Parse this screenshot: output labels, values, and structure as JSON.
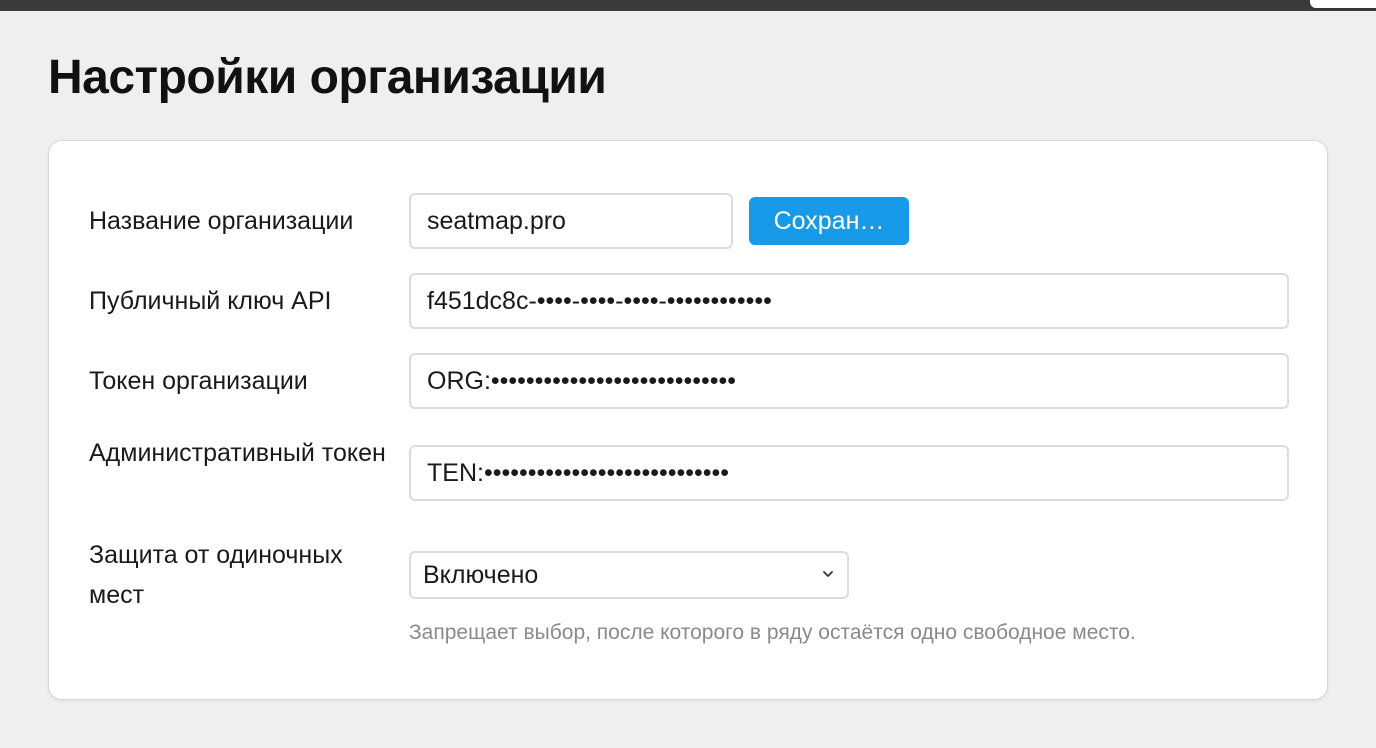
{
  "page": {
    "title": "Настройки организации"
  },
  "form": {
    "org_name": {
      "label": "Название организации",
      "value": "seatmap.pro",
      "save_label": "Сохран…"
    },
    "public_api_key": {
      "label": "Публичный ключ API",
      "value": "f451dc8c-••••-••••-••••-••••••••••••"
    },
    "org_token": {
      "label": "Токен организации",
      "value": "ORG:••••••••••••••••••••••••••••"
    },
    "admin_token": {
      "label": "Административный токен",
      "value": "TEN:••••••••••••••••••••••••••••"
    },
    "single_seat_protection": {
      "label": "Защита от одиночных мест",
      "selected": "Включено",
      "hint": "Запрещает выбор, после которого в ряду остаётся одно свободное место."
    }
  },
  "colors": {
    "accent": "#179be8",
    "background": "#efefef",
    "card": "#ffffff",
    "hint_text": "#8a8a8a"
  },
  "icons": {
    "select_chevron": "chevron-down-icon"
  }
}
